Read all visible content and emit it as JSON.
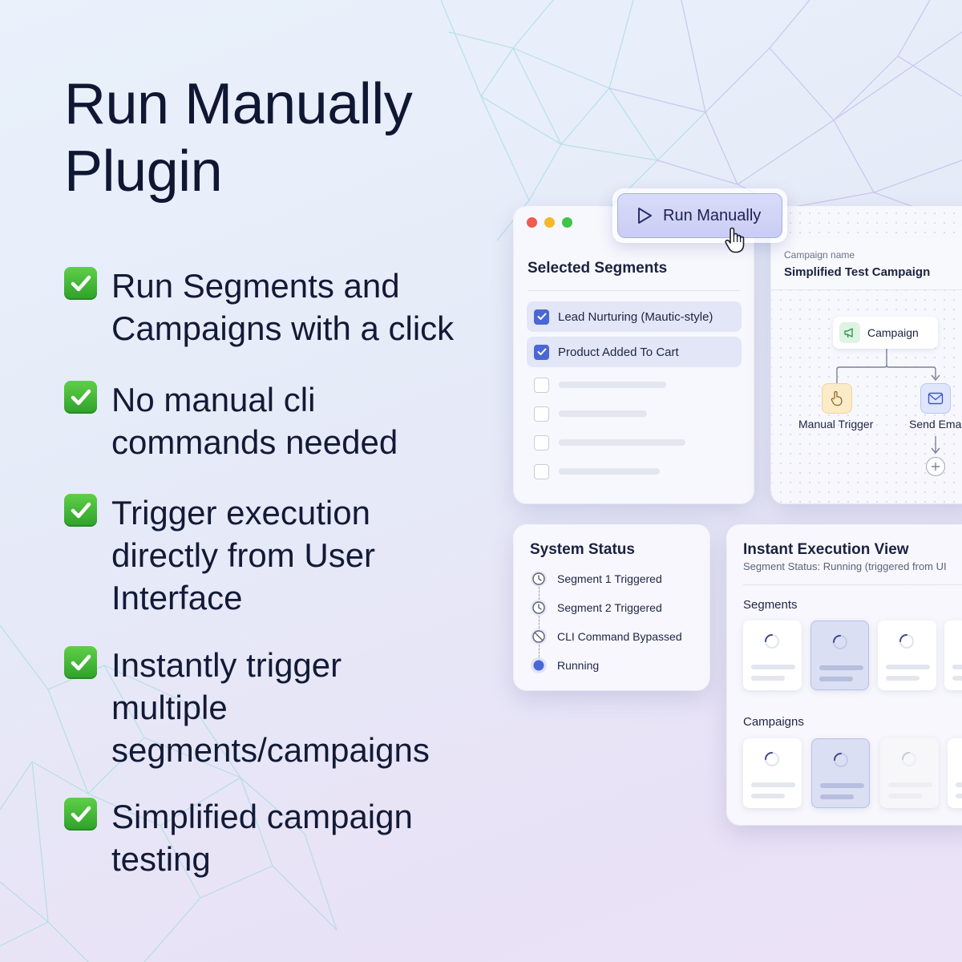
{
  "headline": {
    "line1": "Run Manually",
    "line2": "Plugin"
  },
  "features": [
    {
      "text": "Run Segments and Campaigns with a click"
    },
    {
      "text": "No manual cli commands needed"
    },
    {
      "text": "Trigger execution directly from User Interface"
    },
    {
      "text": "Instantly trigger multiple segments/campaigns"
    },
    {
      "text": "Simplified campaign testing"
    }
  ],
  "run_button": {
    "label": "Run Manually"
  },
  "segments_panel": {
    "title": "Selected Segments",
    "items": [
      {
        "label": "Lead Nurturing (Mautic-style)",
        "checked": true
      },
      {
        "label": "Product Added To Cart",
        "checked": true
      }
    ]
  },
  "campaign_panel": {
    "name_label": "Campaign name",
    "name_value": "Simplified Test Campaign",
    "root_node": "Campaign",
    "trigger_node": "Manual Trigger",
    "action_node": "Send Email"
  },
  "system_status": {
    "title": "System Status",
    "items": [
      {
        "label": "Segment 1 Triggered",
        "icon": "clock-icon"
      },
      {
        "label": "Segment 2 Triggered",
        "icon": "clock-icon"
      },
      {
        "label": "CLI Command Bypassed",
        "icon": "blocked-icon"
      },
      {
        "label": "Running",
        "icon": "running-dot-icon"
      }
    ]
  },
  "execution_view": {
    "title": "Instant Execution View",
    "subtitle": "Segment Status: Running (triggered from UI",
    "segments_label": "Segments",
    "campaigns_label": "Campaigns"
  },
  "colors": {
    "accent": "#4a67d6",
    "button_fill": "#c9cdf3",
    "check_green": "#2ea12a",
    "text_dark": "#0f1733"
  }
}
